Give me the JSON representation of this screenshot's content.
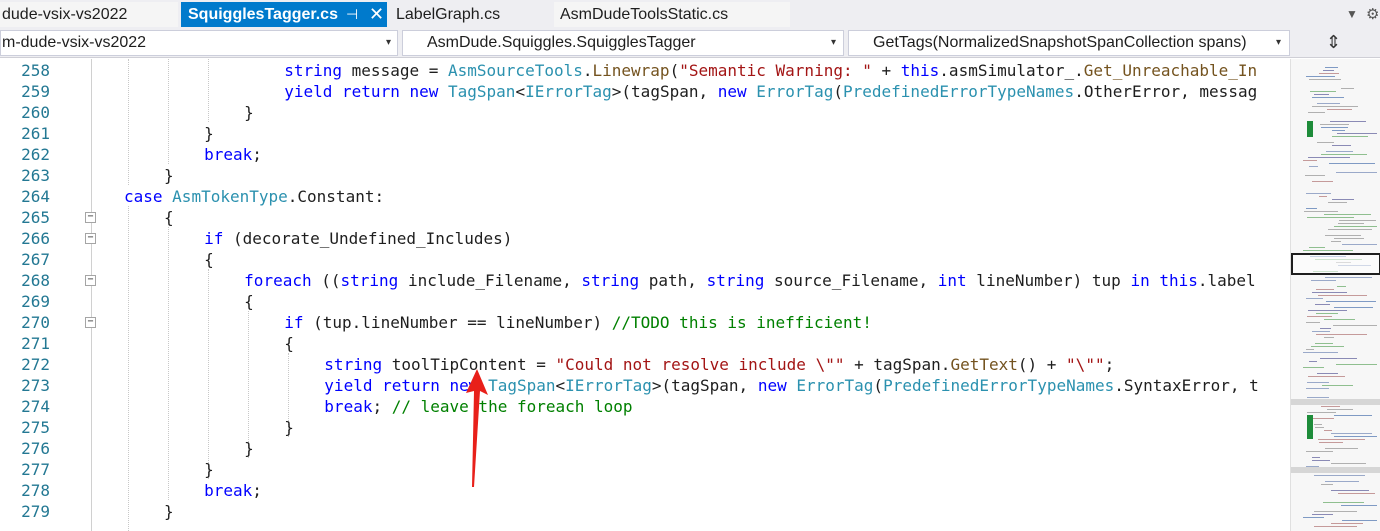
{
  "tabs": [
    {
      "label": "dude-vsix-vs2022"
    },
    {
      "label": "SquigglesTagger.cs",
      "active": true
    },
    {
      "label": "LabelGraph.cs"
    },
    {
      "label": "AsmDudeToolsStatic.cs"
    }
  ],
  "tab_pin_glyph": "⊣",
  "tab_close_glyph": "✕",
  "tab_overflow_glyph": "▼",
  "tab_settings_glyph": "⚙",
  "nav": {
    "project": "m-dude-vsix-vs2022",
    "type": "AsmDude.Squiggles.SquigglesTagger",
    "member": "GetTags(NormalizedSnapshotSpanCollection spans)",
    "arrow_glyph": "▾",
    "split_glyph": "⇕"
  },
  "editor": {
    "line_numbers": [
      "258",
      "259",
      "260",
      "261",
      "262",
      "263",
      "264",
      "265",
      "266",
      "267",
      "268",
      "269",
      "270",
      "271",
      "272",
      "273",
      "274",
      "275",
      "276",
      "277",
      "278",
      "279"
    ],
    "fold_glyph": "−",
    "lines": [
      [
        {
          "t": "string",
          "c": "k"
        },
        {
          "t": " message = "
        },
        {
          "t": "AsmSourceTools",
          "c": "t"
        },
        {
          "t": "."
        },
        {
          "t": "Linewrap",
          "c": "m"
        },
        {
          "t": "("
        },
        {
          "t": "\"Semantic Warning: \"",
          "c": "s"
        },
        {
          "t": " + "
        },
        {
          "t": "this",
          "c": "k"
        },
        {
          "t": ".asmSimulator_."
        },
        {
          "t": "Get_Unreachable_In",
          "c": "m"
        }
      ],
      [
        {
          "t": "yield return new",
          "c": "k"
        },
        {
          "t": " "
        },
        {
          "t": "TagSpan",
          "c": "t"
        },
        {
          "t": "<"
        },
        {
          "t": "IErrorTag",
          "c": "t"
        },
        {
          "t": ">(tagSpan, "
        },
        {
          "t": "new",
          "c": "k"
        },
        {
          "t": " "
        },
        {
          "t": "ErrorTag",
          "c": "t"
        },
        {
          "t": "("
        },
        {
          "t": "PredefinedErrorTypeNames",
          "c": "t"
        },
        {
          "t": ".OtherError, messag"
        }
      ],
      [
        {
          "t": "}"
        }
      ],
      [
        {
          "t": "}"
        }
      ],
      [
        {
          "t": "break",
          "c": "k"
        },
        {
          "t": ";"
        }
      ],
      [
        {
          "t": "}"
        }
      ],
      [
        {
          "t": "case",
          "c": "k"
        },
        {
          "t": " "
        },
        {
          "t": "AsmTokenType",
          "c": "t"
        },
        {
          "t": ".Constant:"
        }
      ],
      [
        {
          "t": "{"
        }
      ],
      [
        {
          "t": "if",
          "c": "k"
        },
        {
          "t": " (decorate_Undefined_Includes)"
        }
      ],
      [
        {
          "t": "{"
        }
      ],
      [
        {
          "t": "foreach",
          "c": "k"
        },
        {
          "t": " (("
        },
        {
          "t": "string",
          "c": "k"
        },
        {
          "t": " include_Filename, "
        },
        {
          "t": "string",
          "c": "k"
        },
        {
          "t": " path, "
        },
        {
          "t": "string",
          "c": "k"
        },
        {
          "t": " source_Filename, "
        },
        {
          "t": "int",
          "c": "k"
        },
        {
          "t": " lineNumber) tup "
        },
        {
          "t": "in",
          "c": "k"
        },
        {
          "t": " "
        },
        {
          "t": "this",
          "c": "k"
        },
        {
          "t": ".label"
        }
      ],
      [
        {
          "t": "{"
        }
      ],
      [
        {
          "t": "if",
          "c": "k"
        },
        {
          "t": " (tup.lineNumber == lineNumber) "
        },
        {
          "t": "//TODO this is inefficient!",
          "c": "c"
        }
      ],
      [
        {
          "t": "{"
        }
      ],
      [
        {
          "t": "string",
          "c": "k"
        },
        {
          "t": " toolTipContent = "
        },
        {
          "t": "\"Could not resolve include \\\"\"",
          "c": "s"
        },
        {
          "t": " + tagSpan."
        },
        {
          "t": "GetText",
          "c": "m"
        },
        {
          "t": "() + "
        },
        {
          "t": "\"\\\"\"",
          "c": "s"
        },
        {
          "t": ";"
        }
      ],
      [
        {
          "t": "yield return new",
          "c": "k"
        },
        {
          "t": " "
        },
        {
          "t": "TagSpan",
          "c": "t"
        },
        {
          "t": "<"
        },
        {
          "t": "IErrorTag",
          "c": "t"
        },
        {
          "t": ">(tagSpan, "
        },
        {
          "t": "new",
          "c": "k"
        },
        {
          "t": " "
        },
        {
          "t": "ErrorTag",
          "c": "t"
        },
        {
          "t": "("
        },
        {
          "t": "PredefinedErrorTypeNames",
          "c": "t"
        },
        {
          "t": ".SyntaxError, t"
        }
      ],
      [
        {
          "t": "break",
          "c": "k"
        },
        {
          "t": "; "
        },
        {
          "t": "// leave the foreach loop",
          "c": "c"
        }
      ],
      [
        {
          "t": "}"
        }
      ],
      [
        {
          "t": "}"
        }
      ],
      [
        {
          "t": "}"
        }
      ],
      [
        {
          "t": "break",
          "c": "k"
        },
        {
          "t": ";"
        }
      ],
      [
        {
          "t": "}"
        }
      ]
    ]
  },
  "colors": {
    "accent": "#007acc",
    "keyword": "#0000ff",
    "type": "#2b91af",
    "string": "#a31515",
    "comment": "#008000",
    "line_number": "#237893",
    "annotation_arrow": "#e8201a"
  }
}
